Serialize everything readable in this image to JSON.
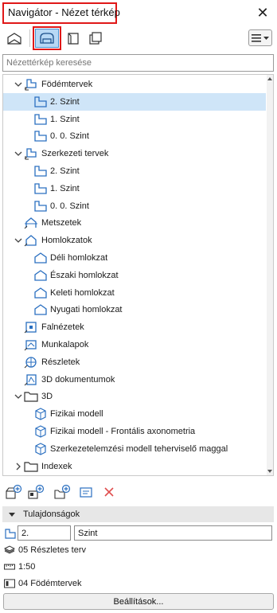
{
  "window": {
    "title": "Navigátor - Nézet térkép",
    "close_icon": "close-icon"
  },
  "toolbar": {
    "buttons": [
      {
        "name": "project-map-icon",
        "active": false
      },
      {
        "name": "view-map-icon",
        "active": true
      },
      {
        "name": "layout-book-icon",
        "active": false
      },
      {
        "name": "publisher-sets-icon",
        "active": false
      }
    ],
    "menu_icon": "hamburger-menu-icon"
  },
  "search": {
    "placeholder": "Nézettérkép keresése"
  },
  "tree": {
    "items": [
      {
        "label": "Födémtervek",
        "level": 0,
        "expanded": true,
        "icon": "floor-plan-folder-icon"
      },
      {
        "label": "2. Szint",
        "level": 1,
        "selected": true,
        "icon": "floor-plan-icon"
      },
      {
        "label": "1. Szint",
        "level": 1,
        "icon": "floor-plan-icon"
      },
      {
        "label": "0. 0. Szint",
        "level": 1,
        "icon": "floor-plan-icon"
      },
      {
        "label": "Szerkezeti tervek",
        "level": 0,
        "expanded": true,
        "icon": "floor-plan-folder-icon"
      },
      {
        "label": "2. Szint",
        "level": 1,
        "icon": "floor-plan-icon"
      },
      {
        "label": "1. Szint",
        "level": 1,
        "icon": "floor-plan-icon"
      },
      {
        "label": "0. 0. Szint",
        "level": 1,
        "icon": "floor-plan-icon"
      },
      {
        "label": "Metszetek",
        "level": 0,
        "icon": "section-icon"
      },
      {
        "label": "Homlokzatok",
        "level": 0,
        "expanded": true,
        "icon": "elevation-folder-icon"
      },
      {
        "label": "Déli homlokzat",
        "level": 1,
        "icon": "elevation-icon"
      },
      {
        "label": "Északi homlokzat",
        "level": 1,
        "icon": "elevation-icon"
      },
      {
        "label": "Keleti homlokzat",
        "level": 1,
        "icon": "elevation-icon"
      },
      {
        "label": "Nyugati homlokzat",
        "level": 1,
        "icon": "elevation-icon"
      },
      {
        "label": "Falnézetek",
        "level": 0,
        "icon": "interior-elevation-icon"
      },
      {
        "label": "Munkalapok",
        "level": 0,
        "icon": "worksheet-icon"
      },
      {
        "label": "Részletek",
        "level": 0,
        "icon": "detail-icon"
      },
      {
        "label": "3D dokumentumok",
        "level": 0,
        "icon": "3d-document-icon"
      },
      {
        "label": "3D",
        "level": 0,
        "expanded": true,
        "icon": "folder-icon"
      },
      {
        "label": "Fizikai modell",
        "level": 1,
        "icon": "3d-view-icon"
      },
      {
        "label": "Fizikai modell - Frontális axonometria",
        "level": 1,
        "icon": "3d-view-icon"
      },
      {
        "label": "Szerkezetelemzési modell teherviselő maggal",
        "level": 1,
        "icon": "3d-view-icon"
      },
      {
        "label": "Indexek",
        "level": 0,
        "expanded": false,
        "icon": "folder-icon"
      }
    ]
  },
  "bottom_toolbar": {
    "buttons": [
      "new-view-icon",
      "clone-folder-icon",
      "new-folder-icon",
      "view-settings-icon",
      "delete-icon"
    ]
  },
  "properties": {
    "header": "Tulajdonságok",
    "id_value": "2.",
    "name_value": "Szint",
    "layer_combination": "05 Részletes terv",
    "scale": "1:50",
    "model_view_option": "04 Födémtervek",
    "settings_button": "Beállítások..."
  },
  "colors": {
    "accent_highlight": "#e01818",
    "selection": "#cfe5f8",
    "icon_blue": "#2a6fc0",
    "delete_red": "#e05050"
  }
}
